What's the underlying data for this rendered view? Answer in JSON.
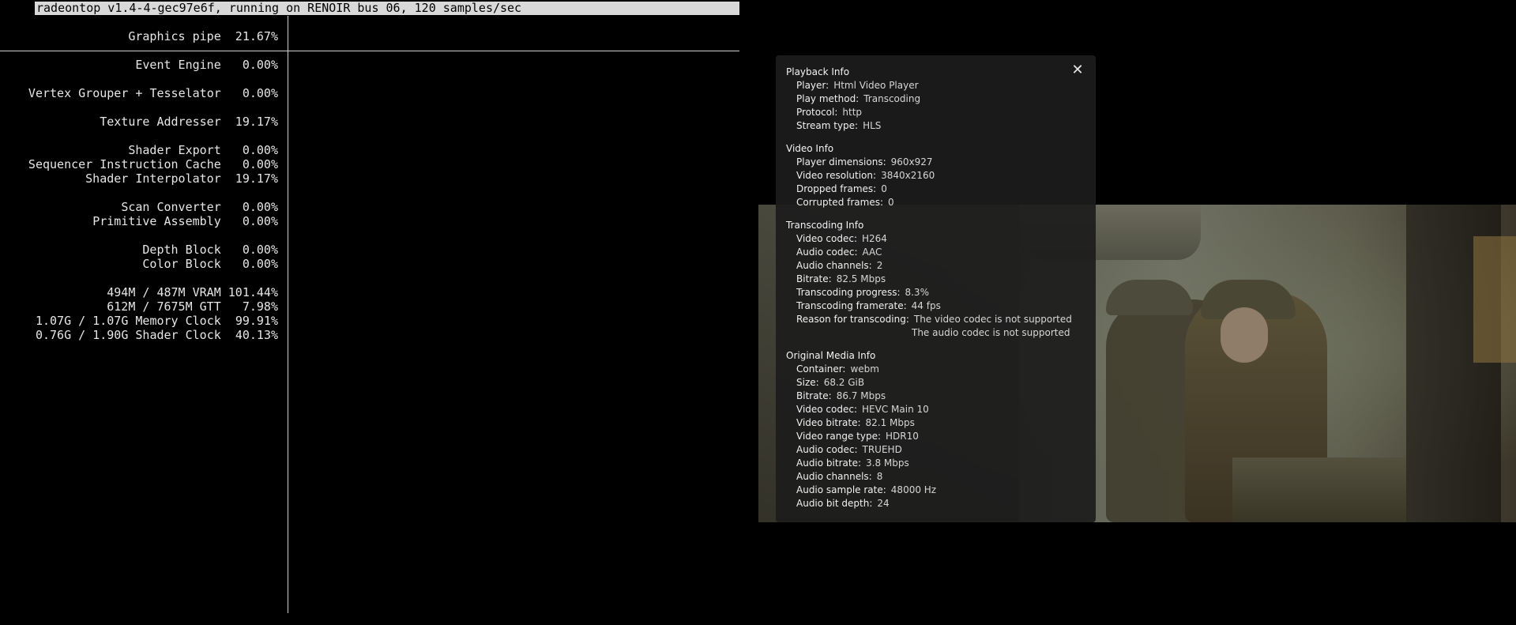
{
  "terminal": {
    "title": "radeontop v1.4-4-gec97e6f, running on RENOIR bus 06, 120 samples/sec",
    "stats": [
      "Graphics pipe  21.67%",
      "Event Engine   0.00%",
      "Vertex Grouper + Tesselator   0.00%",
      "Texture Addresser  19.17%",
      "Shader Export   0.00%",
      "Sequencer Instruction Cache   0.00%",
      "Shader Interpolator  19.17%",
      "Scan Converter   0.00%",
      "Primitive Assembly   0.00%",
      "Depth Block   0.00%",
      "Color Block   0.00%",
      "494M / 487M VRAM 101.44%",
      "612M / 7675M GTT   7.98%",
      "1.07G / 1.07G Memory Clock  99.91%",
      "0.76G / 1.90G Shader Clock  40.13%"
    ]
  },
  "overlay": {
    "close_icon": "close-icon",
    "sections": {
      "playback": {
        "title": "Playback Info",
        "rows": [
          {
            "label": "Player:",
            "value": "Html Video Player"
          },
          {
            "label": "Play method:",
            "value": "Transcoding"
          },
          {
            "label": "Protocol:",
            "value": "http"
          },
          {
            "label": "Stream type:",
            "value": "HLS"
          }
        ]
      },
      "video": {
        "title": "Video Info",
        "rows": [
          {
            "label": "Player dimensions:",
            "value": "960x927"
          },
          {
            "label": "Video resolution:",
            "value": "3840x2160"
          },
          {
            "label": "Dropped frames:",
            "value": "0"
          },
          {
            "label": "Corrupted frames:",
            "value": "0"
          }
        ]
      },
      "transcoding": {
        "title": "Transcoding Info",
        "rows": [
          {
            "label": "Video codec:",
            "value": "H264"
          },
          {
            "label": "Audio codec:",
            "value": "AAC"
          },
          {
            "label": "Audio channels:",
            "value": "2"
          },
          {
            "label": "Bitrate:",
            "value": "82.5 Mbps"
          },
          {
            "label": "Transcoding progress:",
            "value": "8.3%"
          },
          {
            "label": "Transcoding framerate:",
            "value": "44 fps"
          },
          {
            "label": "Reason for transcoding:",
            "value": "The video codec is not supported"
          }
        ],
        "reason_continued": "The audio codec is not supported"
      },
      "original": {
        "title": "Original Media Info",
        "rows": [
          {
            "label": "Container:",
            "value": "webm"
          },
          {
            "label": "Size:",
            "value": "68.2 GiB"
          },
          {
            "label": "Bitrate:",
            "value": "86.7 Mbps"
          },
          {
            "label": "Video codec:",
            "value": "HEVC Main 10"
          },
          {
            "label": "Video bitrate:",
            "value": "82.1 Mbps"
          },
          {
            "label": "Video range type:",
            "value": "HDR10"
          },
          {
            "label": "Audio codec:",
            "value": "TRUEHD"
          },
          {
            "label": "Audio bitrate:",
            "value": "3.8 Mbps"
          },
          {
            "label": "Audio channels:",
            "value": "8"
          },
          {
            "label": "Audio sample rate:",
            "value": "48000 Hz"
          },
          {
            "label": "Audio bit depth:",
            "value": "24"
          }
        ]
      }
    }
  }
}
